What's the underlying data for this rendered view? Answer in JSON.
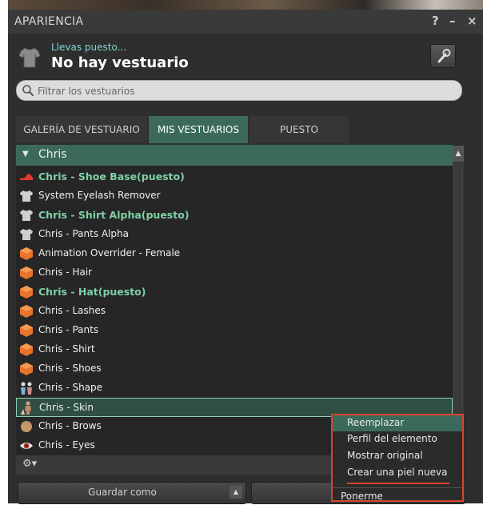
{
  "window": {
    "title": "APARIENCIA",
    "help": "?",
    "minimize": "–",
    "close": "×"
  },
  "header": {
    "wearing_label": "Llevas puesto...",
    "outfit_name": "No hay vestuario"
  },
  "search": {
    "placeholder": "Filtrar los vestuarios",
    "value": ""
  },
  "tabs": [
    {
      "label": "GALERÍA DE VESTUARIO",
      "active": false
    },
    {
      "label": "MIS VESTUARIOS",
      "active": true
    },
    {
      "label": "PUESTO",
      "active": false
    }
  ],
  "folder": {
    "name": "Chris",
    "expanded": true
  },
  "items": [
    {
      "label": "Chris - Shoe Base(puesto)",
      "icon": "shoe-icon",
      "worn": true
    },
    {
      "label": "System Eyelash Remover",
      "icon": "shirt-icon",
      "worn": false
    },
    {
      "label": "Chris - Shirt Alpha(puesto)",
      "icon": "shirt-icon",
      "worn": true
    },
    {
      "label": "Chris - Pants Alpha",
      "icon": "shirt-icon",
      "worn": false
    },
    {
      "label": "Animation Overrider - Female",
      "icon": "object-box-icon",
      "worn": false
    },
    {
      "label": "Chris - Hair",
      "icon": "object-box-icon",
      "worn": false
    },
    {
      "label": "Chris - Hat(puesto)",
      "icon": "object-box-icon",
      "worn": true
    },
    {
      "label": "Chris - Lashes",
      "icon": "object-box-icon",
      "worn": false
    },
    {
      "label": "Chris - Pants",
      "icon": "object-box-icon",
      "worn": false
    },
    {
      "label": "Chris - Shirt",
      "icon": "object-box-icon",
      "worn": false
    },
    {
      "label": "Chris - Shoes",
      "icon": "object-box-icon",
      "worn": false
    },
    {
      "label": "Chris - Shape",
      "icon": "shape-icon",
      "worn": false
    },
    {
      "label": "Chris - Skin",
      "icon": "skin-icon",
      "worn": false,
      "selected": true
    },
    {
      "label": "Chris - Brows",
      "icon": "hair-icon",
      "worn": false
    },
    {
      "label": "Chris - Eyes",
      "icon": "eye-icon",
      "worn": false
    }
  ],
  "bottom": {
    "gear_label": "⚙▾",
    "save_as": "Guardar como",
    "wear": "Ponerme"
  },
  "context_menu": {
    "items": [
      "Reemplazar",
      "Perfil del elemento",
      "Mostrar original",
      "Crear una piel nueva"
    ],
    "highlighted": "Reemplazar"
  },
  "colors": {
    "accent_green": "#3b6a5c",
    "worn_text": "#7fd0a8",
    "annotation_red": "#d9442b"
  }
}
